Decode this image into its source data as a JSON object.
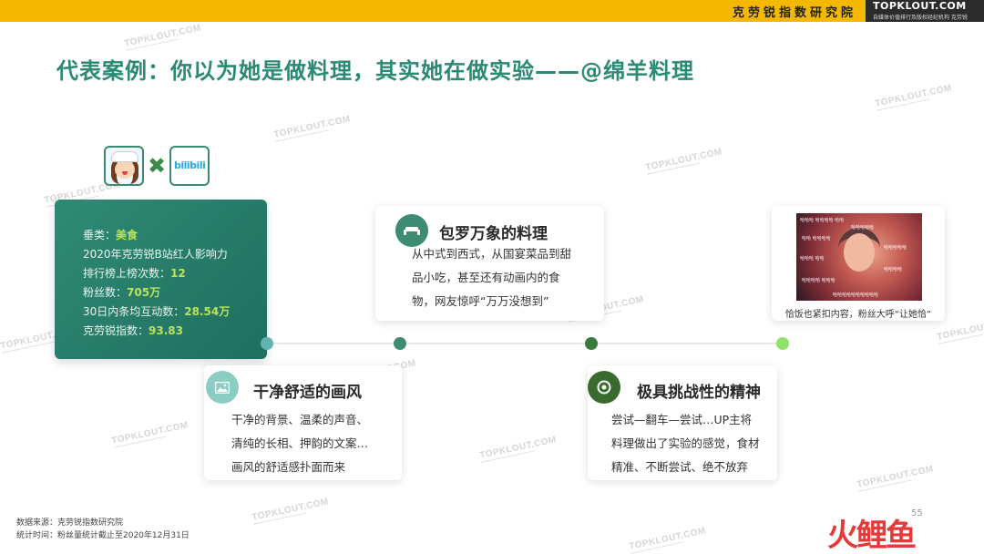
{
  "header": {
    "org_name": "克劳锐指数研究院",
    "brand": "TOPKLOUT.COM",
    "brand_sub": "自媒体价值排行及版权经纪机构 克劳锐"
  },
  "title": "代表案例：你以为她是做料理，其实她在做实验——@绵羊料理",
  "watermark": "TOPKLOUT.COM",
  "logos": {
    "times": "✖",
    "bilibili": "bilibili"
  },
  "profile": {
    "category_label": "垂类：",
    "category_value": "美食",
    "ranking_title": "2020年克劳锐B站红人影响力",
    "ranking_label": "排行榜上榜次数：",
    "ranking_value": "12",
    "fans_label": "粉丝数：",
    "fans_value": "705万",
    "interaction_label": "30日内条均互动数：",
    "interaction_value": "28.54万",
    "index_label": "克劳锐指数：",
    "index_value": "93.83"
  },
  "cards": {
    "variety": {
      "title": "包罗万象的料理",
      "lines": [
        "从中式到西式，从国宴菜品到甜",
        "品小吃，甚至还有动画内的食",
        "物，网友惊呼“万万没想到”"
      ]
    },
    "style": {
      "title": "干净舒适的画风",
      "lines": [
        "干净的背景、温柔的声音、",
        "清纯的长相、押韵的文案…",
        "画风的舒适感扑面而来"
      ]
    },
    "spirit": {
      "title": "极具挑战性的精神",
      "lines": [
        "尝试—翻车—尝试…UP主将",
        "料理做出了实验的感觉，食材",
        "精准、不断尝试、绝不放弃"
      ]
    },
    "photo_caption": "恰饭也紧扣内容，粉丝大呼“让她恰”"
  },
  "footer": {
    "source": "数据来源：克劳锐指数研究院",
    "time": "统计时间：粉丝量统计截止至2020年12月31日"
  },
  "page_number": "55",
  "corner_logo": "火鲤鱼",
  "colors": {
    "accent_yellow": "#f5b800",
    "title_green": "#2a8a74",
    "card_green": "#2f8a74",
    "highlight": "#b9e35a"
  }
}
